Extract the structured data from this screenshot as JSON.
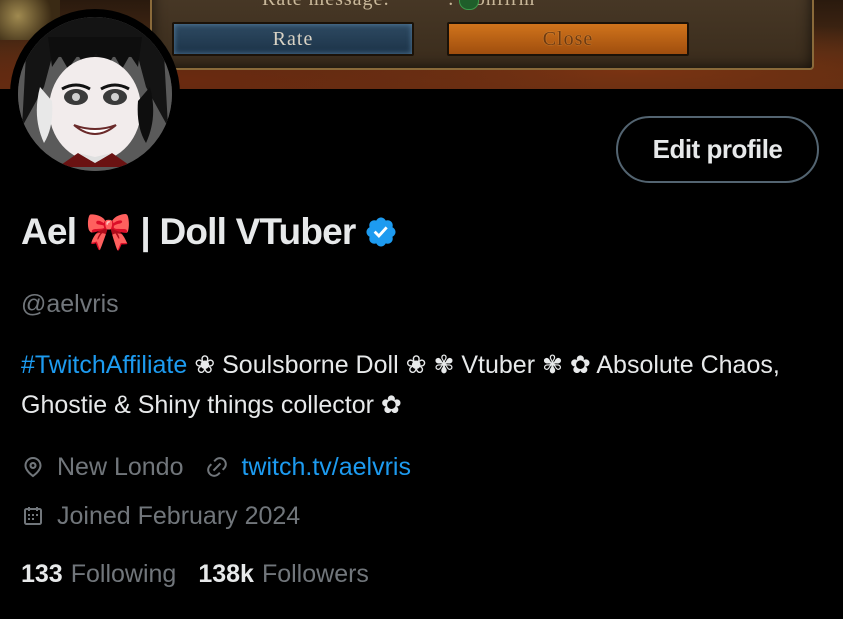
{
  "banner": {
    "prompt_text": "Rate message:",
    "confirm_text": ": Confirm",
    "rate_label": "Rate",
    "close_label": "Close"
  },
  "header": {
    "edit_profile_label": "Edit profile"
  },
  "profile": {
    "display_name": "Ael 🎀 | Doll VTuber",
    "handle": "@aelvris",
    "bio": {
      "hashtag": "#TwitchAffiliate",
      "text": " ❀ Soulsborne Doll ❀ ✾ Vtuber ✾ ✿ Absolute Chaos, Ghostie & Shiny things collector ✿"
    },
    "location": "New Londo",
    "website": "twitch.tv/aelvris",
    "joined": "Joined February 2024",
    "following_count": "133",
    "following_label": "Following",
    "followers_count": "138k",
    "followers_label": "Followers"
  },
  "icons": {
    "verified": "verified-badge-icon",
    "location": "location-pin-icon",
    "link": "link-icon",
    "calendar": "calendar-icon"
  },
  "colors": {
    "background": "#000000",
    "text_primary": "#e7e9ea",
    "text_secondary": "#71767b",
    "accent_link": "#1d9bf0",
    "verified": "#1d9bf0",
    "button_border": "#536471"
  }
}
